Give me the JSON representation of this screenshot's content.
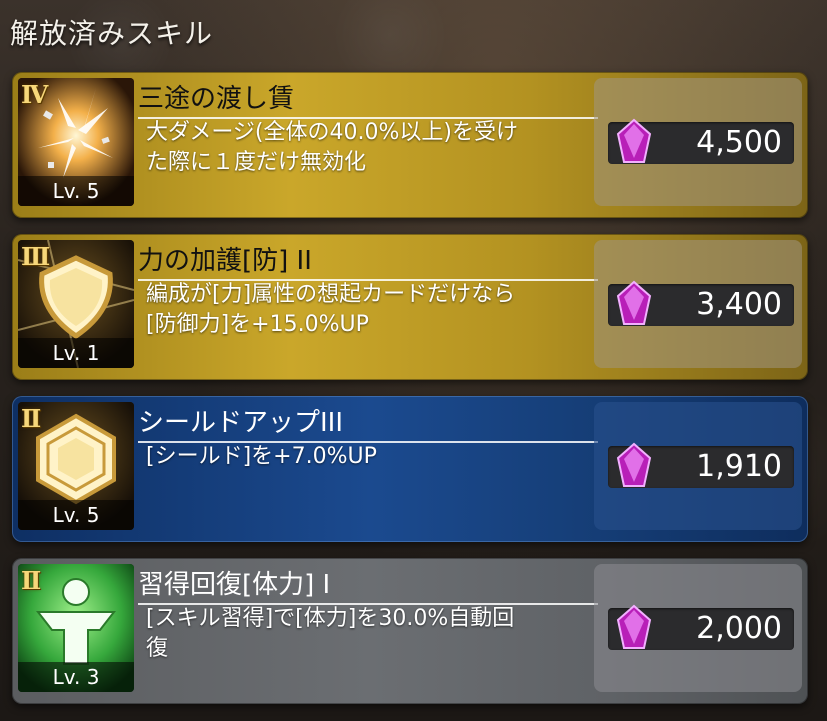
{
  "header": {
    "title": "解放済みスキル"
  },
  "skills": [
    {
      "rank": "Ⅳ",
      "level": "Lv. 5",
      "name": "三途の渡し賃",
      "desc_lines": [
        "大ダメージ(全体の40.0%以上)を受け",
        "た際に１度だけ無効化"
      ],
      "cost": "4,500"
    },
    {
      "rank": "Ⅲ",
      "level": "Lv. 1",
      "name": "力の加護[防] II",
      "desc_lines": [
        "編成が[力]属性の想起カードだけなら",
        "[防御力]を+15.0%UP"
      ],
      "cost": "3,400"
    },
    {
      "rank": "Ⅱ",
      "level": "Lv. 5",
      "name": "シールドアップIII",
      "desc_lines": [
        "[シールド]を+7.0%UP",
        ""
      ],
      "cost": "1,910"
    },
    {
      "rank": "Ⅱ",
      "level": "Lv. 3",
      "name": "習得回復[体力] I",
      "desc_lines": [
        "[スキル習得]で[体力]を30.0%自動回",
        "復"
      ],
      "cost": "2,000"
    }
  ],
  "colors": {
    "gold_card": "#caa72a",
    "blue_card": "#1b4a8f",
    "gray_card": "#6b6e72",
    "gem": "#c020c0"
  },
  "icons": [
    "shatter-icon",
    "shield-icon",
    "hexagon-shield-icon",
    "figure-heal-icon",
    "gem-icon"
  ]
}
